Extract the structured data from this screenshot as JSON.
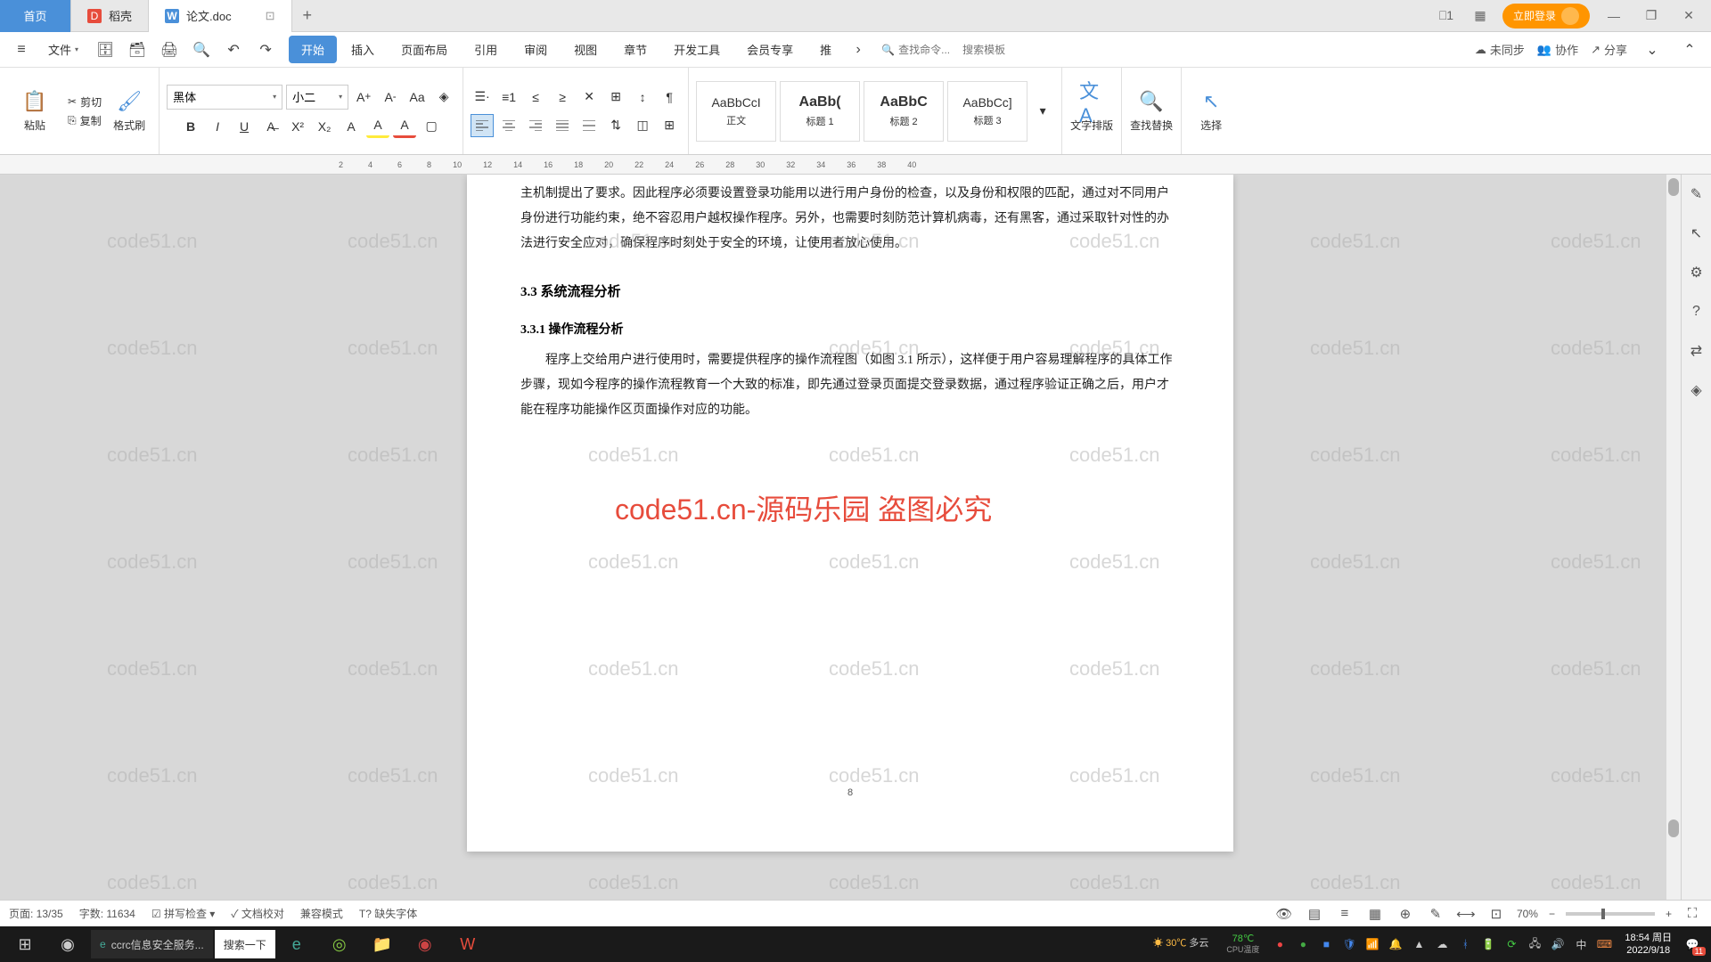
{
  "tabs": {
    "home": "首页",
    "dock": "稻壳",
    "doc": "论文.doc",
    "add": "+"
  },
  "window_controls": {
    "login": "立即登录",
    "minimize": "—",
    "restore": "❐",
    "close": "✕"
  },
  "menu": {
    "file": "文件",
    "items": [
      "开始",
      "插入",
      "页面布局",
      "引用",
      "审阅",
      "视图",
      "章节",
      "开发工具",
      "会员专享",
      "推"
    ],
    "search_placeholder": "查找命令...",
    "template_search": "搜索模板",
    "unsync": "未同步",
    "collab": "协作",
    "share": "分享"
  },
  "ribbon": {
    "paste": "粘贴",
    "cut": "剪切",
    "copy": "复制",
    "format_painter": "格式刷",
    "font_name": "黑体",
    "font_size": "小二",
    "styles": [
      {
        "preview": "AaBbCcI",
        "name": "正文"
      },
      {
        "preview": "AaBb(",
        "name": "标题 1",
        "big": true
      },
      {
        "preview": "AaBbC",
        "name": "标题 2",
        "big": true
      },
      {
        "preview": "AaBbCc]",
        "name": "标题 3"
      }
    ],
    "text_layout": "文字排版",
    "find_replace": "查找替换",
    "select": "选择"
  },
  "ruler_ticks": [
    "2",
    "4",
    "6",
    "8",
    "10",
    "12",
    "14",
    "16",
    "18",
    "20",
    "22",
    "24",
    "26",
    "28",
    "30",
    "32",
    "34",
    "36",
    "38",
    "40"
  ],
  "document": {
    "p1": "主机制提出了要求。因此程序必须要设置登录功能用以进行用户身份的检查，以及身份和权限的匹配，通过对不同用户身份进行功能约束，绝不容忍用户越权操作程序。另外，也需要时刻防范计算机病毒，还有黑客，通过采取针对性的办法进行安全应对，确保程序时刻处于安全的环境，让使用者放心使用。",
    "h3": "3.3  系统流程分析",
    "h4": "3.3.1  操作流程分析",
    "p2": "程序上交给用户进行使用时，需要提供程序的操作流程图（如图 3.1 所示），这样便于用户容易理解程序的具体工作步骤，现如今程序的操作流程教育一个大致的标准，即先通过登录页面提交登录数据，通过程序验证正确之后，用户才能在程序功能操作区页面操作对应的功能。",
    "page_num": "8"
  },
  "watermark": "code51.cn",
  "watermark_red": "code51.cn-源码乐园 盗图必究",
  "status": {
    "page": "页面: 13/35",
    "words": "字数: 11634",
    "spellcheck": "拼写检查",
    "proofread": "文档校对",
    "compat": "兼容模式",
    "missing_font": "缺失字体",
    "zoom": "70%"
  },
  "taskbar": {
    "browser_title": "ccrc信息安全服务...",
    "search": "搜索一下",
    "weather_temp": "30℃",
    "weather_cond": "多云",
    "cpu_temp": "78℃",
    "cpu_label": "CPU温度",
    "ime": "中",
    "time": "18:54 周日",
    "date": "2022/9/18",
    "notif_count": "11"
  }
}
